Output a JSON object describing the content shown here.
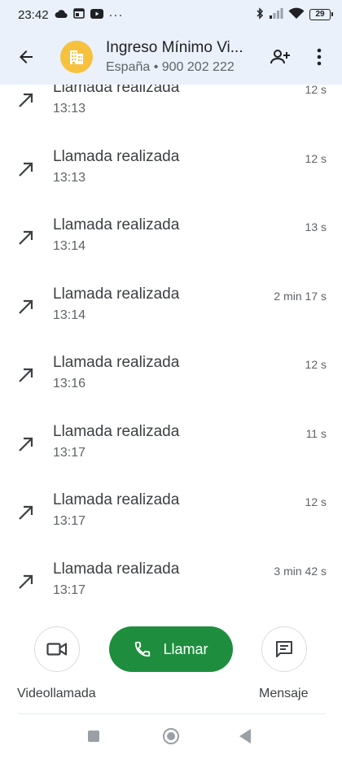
{
  "status_bar": {
    "time": "23:42",
    "more": "···",
    "battery": "29",
    "icons": [
      "cloud-icon",
      "calendar-icon",
      "youtube-icon",
      "bluetooth-icon",
      "signal-icon",
      "wifi-icon",
      "battery-icon"
    ]
  },
  "header": {
    "contact_name": "Ingreso Mínimo Vi...",
    "contact_sub": "España • 900 202 222",
    "avatar_icon": "building-icon",
    "accent": "#f6c23e",
    "background": "#eaf1fb"
  },
  "calls": [
    {
      "title": "Llamada realizada",
      "time": "13:13",
      "duration": "12 s"
    },
    {
      "title": "Llamada realizada",
      "time": "13:13",
      "duration": "12 s"
    },
    {
      "title": "Llamada realizada",
      "time": "13:14",
      "duration": "13 s"
    },
    {
      "title": "Llamada realizada",
      "time": "13:14",
      "duration": "2 min 17 s"
    },
    {
      "title": "Llamada realizada",
      "time": "13:16",
      "duration": "12 s"
    },
    {
      "title": "Llamada realizada",
      "time": "13:17",
      "duration": "11 s"
    },
    {
      "title": "Llamada realizada",
      "time": "13:17",
      "duration": "12 s"
    },
    {
      "title": "Llamada realizada",
      "time": "13:17",
      "duration": "3 min 42 s"
    }
  ],
  "actions": {
    "video_label": "Videollamada",
    "call_label": "Llamar",
    "message_label": "Mensaje",
    "call_color": "#1e8e3e"
  }
}
